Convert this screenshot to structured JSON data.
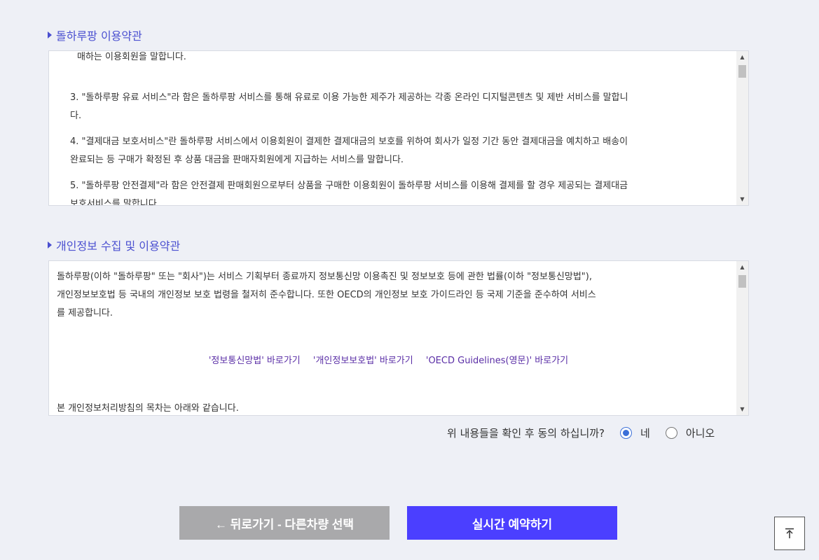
{
  "terms": {
    "title": "돌하루팡 이용약관",
    "lines": [
      "매하는 이용회원을 말합니다.",
      "",
      "3. \"돌하루팡 유료 서비스\"라 함은 돌하루팡 서비스를 통해 유료로 이용 가능한 제주가 제공하는 각종 온라인 디지털콘텐츠 및 제반 서비스를 말합니",
      "다.",
      "4. \"결제대금 보호서비스\"란 돌하루팡 서비스에서 이용회원이 결제한 결제대금의 보호를 위하여 회사가 일정 기간 동안 결제대금을 예치하고 배송이",
      "완료되는 등 구매가 확정된 후 상품 대금을 판매자회원에게 지급하는 서비스를 말합니다.",
      "5. \"돌하루팡 안전결제\"라 함은 안전결제 판매회원으로부터 상품을 구매한 이용회원이 돌하루팡 서비스를 이용해 결제를 할 경우 제공되는 결제대금",
      "보호서비스를 말합니다."
    ]
  },
  "privacy": {
    "title": "개인정보 수집 및 이용약관",
    "intro_lines": [
      "돌하루팡(이하 \"돌하루팡\" 또는 \"회사\")는 서비스 기획부터 종료까지 정보통신망 이용촉진 및 정보보호 등에 관한 법률(이하 \"정보통신망법\"),",
      "개인정보보호법 등 국내의 개인정보 보호 법령을 철저히 준수합니다. 또한 OECD의 개인정보 보호 가이드라인 등 국제 기준을 준수하여 서비스",
      "를 제공합니다."
    ],
    "links": [
      "'정보통신망법' 바로가기",
      "'개인정보보호법' 바로가기",
      "'OECD Guidelines(영문)' 바로가기"
    ],
    "toc_line": "본 개인정보처리방침의 목차는 아래와 같습니다."
  },
  "consent": {
    "question": "위 내용들을 확인 후 동의 하십니까?",
    "yes_label": "네",
    "no_label": "아니오",
    "selected": "yes"
  },
  "buttons": {
    "back_label": "← 뒤로가기 - 다른차량 선택",
    "reserve_label": "실시간 예약하기"
  },
  "icons": {
    "scroll_up": "▲",
    "scroll_down": "▼",
    "to_top": "to-top-icon"
  },
  "colors": {
    "accent": "#4b3fff",
    "title": "#4a4fd0",
    "link": "#5a2ea6",
    "back_button": "#a9a9ab"
  }
}
